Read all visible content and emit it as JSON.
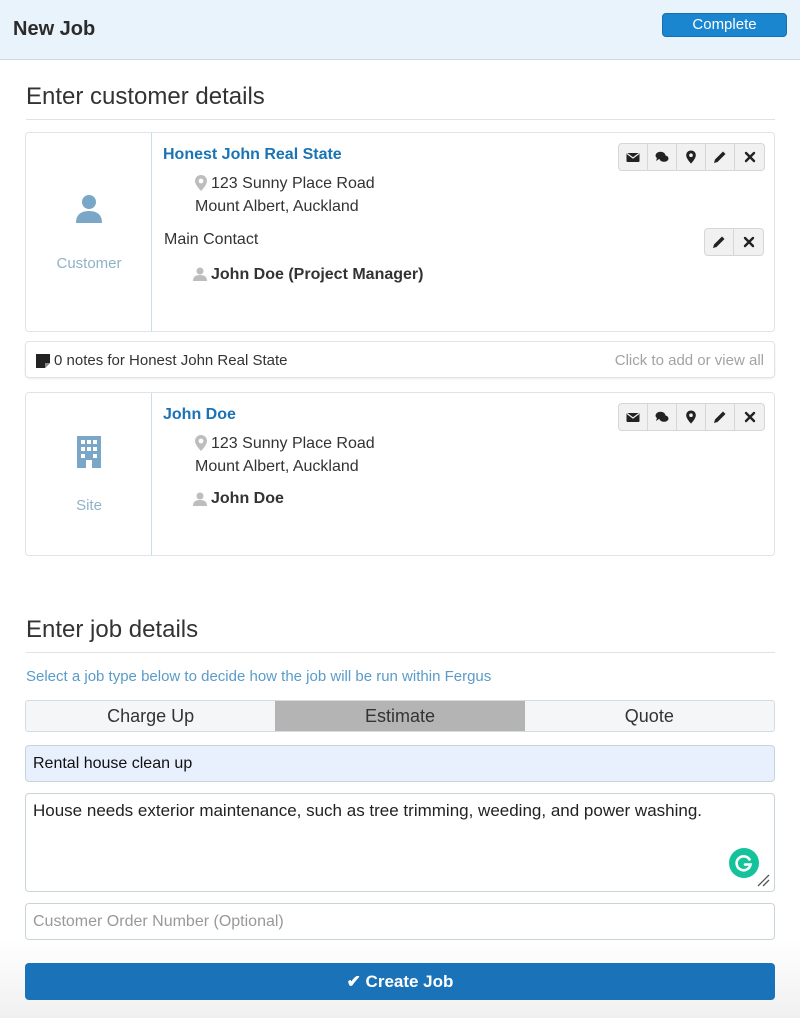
{
  "header": {
    "title": "New Job",
    "complete_label": "Complete"
  },
  "customer_section": {
    "title": "Enter customer details",
    "customer_card": {
      "label": "Customer",
      "name": "Honest John Real State",
      "address_line1": "123 Sunny Place Road",
      "address_line2": "Mount Albert, Auckland",
      "main_contact_label": "Main Contact",
      "contact": "John Doe (Project Manager)",
      "actions": [
        "envelope-icon",
        "comments-icon",
        "map-marker-icon",
        "pencil-icon",
        "times-icon"
      ],
      "contact_actions": [
        "pencil-icon",
        "times-icon"
      ]
    },
    "notes": {
      "text": "0 notes for Honest John Real State",
      "hint": "Click to add or view all"
    },
    "site_card": {
      "label": "Site",
      "name": "John Doe",
      "address_line1": "123 Sunny Place Road",
      "address_line2": "Mount Albert, Auckland",
      "contact": "John Doe",
      "actions": [
        "envelope-icon",
        "comments-icon",
        "map-marker-icon",
        "pencil-icon",
        "times-icon"
      ]
    }
  },
  "job_section": {
    "title": "Enter job details",
    "hint": "Select a job type below to decide how the job will be run within Fergus",
    "job_types": [
      "Charge Up",
      "Estimate",
      "Quote"
    ],
    "selected_job_type": "Estimate",
    "title_value": "Rental house clean up",
    "description_value": "House needs exterior maintenance, such as tree trimming, weeding, and power washing.",
    "order_placeholder": "Customer Order Number (Optional)",
    "create_label": "✔ Create Job"
  },
  "colors": {
    "accent": "#1a72b8",
    "link": "#1a73b5",
    "header_bg": "#e8f3fb",
    "active_segment": "#b4b4b4"
  }
}
